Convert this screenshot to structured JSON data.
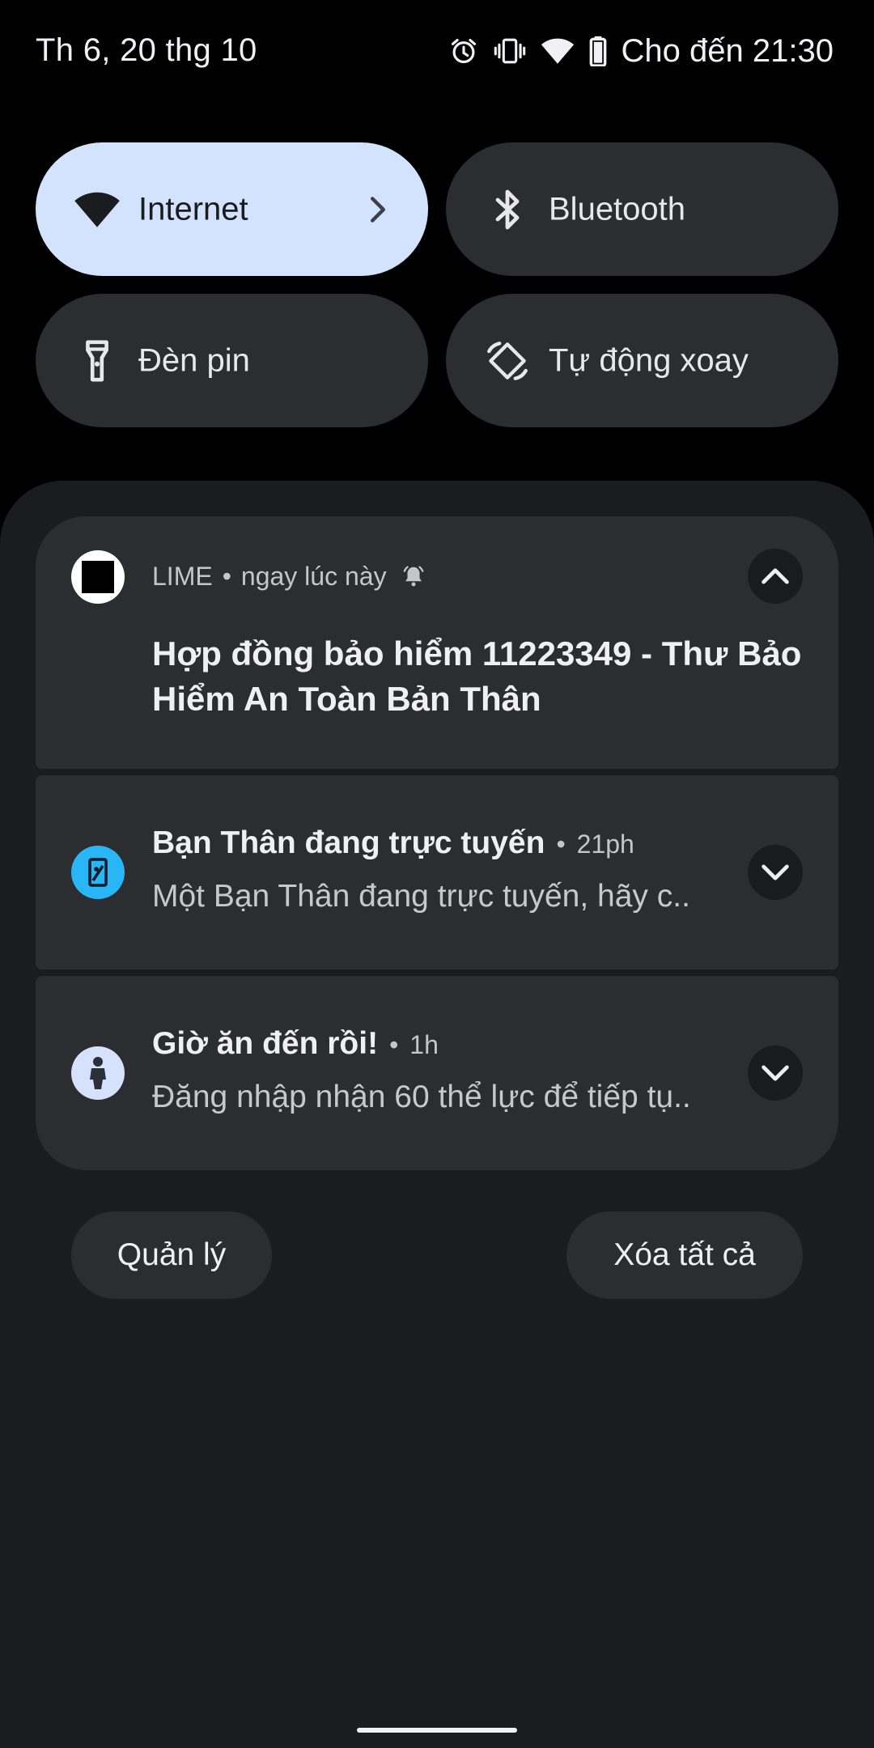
{
  "status_bar": {
    "date": "Th 6, 20 thg 10",
    "battery_text": "Cho đến 21:30",
    "icons": [
      "alarm-icon",
      "vibrate-icon",
      "wifi-icon",
      "battery-icon"
    ]
  },
  "quick_tiles": [
    {
      "label": "Internet",
      "icon": "wifi-icon",
      "active": true,
      "has_chevron": true
    },
    {
      "label": "Bluetooth",
      "icon": "bluetooth-icon",
      "active": false
    },
    {
      "label": "Đèn pin",
      "icon": "flashlight-icon",
      "active": false
    },
    {
      "label": "Tự động xoay",
      "icon": "auto-rotate-icon",
      "active": false
    }
  ],
  "notifications": [
    {
      "app": "LIME",
      "time": "ngay lúc này",
      "title": "Hợp đồng bảo hiểm 11223349 - Thư Bảo Hiểm An Toàn Bản Thân",
      "expanded": true,
      "icon": "lime-app-icon"
    },
    {
      "title": "Bạn Thân đang trực tuyến",
      "time": "21ph",
      "text": "Một Bạn Thân đang trực tuyến, hãy c..",
      "expanded": false,
      "icon": "friend-app-icon",
      "icon_color": "#29b6f6"
    },
    {
      "title": "Giờ ăn đến rồi!",
      "time": "1h",
      "text": "Đăng nhập nhận 60 thể lực để tiếp tụ..",
      "expanded": false,
      "icon": "game-app-icon",
      "icon_color": "#d6e2fb"
    }
  ],
  "separator": "•",
  "footer": {
    "manage_label": "Quản lý",
    "clear_all_label": "Xóa tất cả"
  },
  "colors": {
    "active_tile": "#d3e3fd",
    "tile": "#2c2d31",
    "shade": "#1b1c1f"
  }
}
